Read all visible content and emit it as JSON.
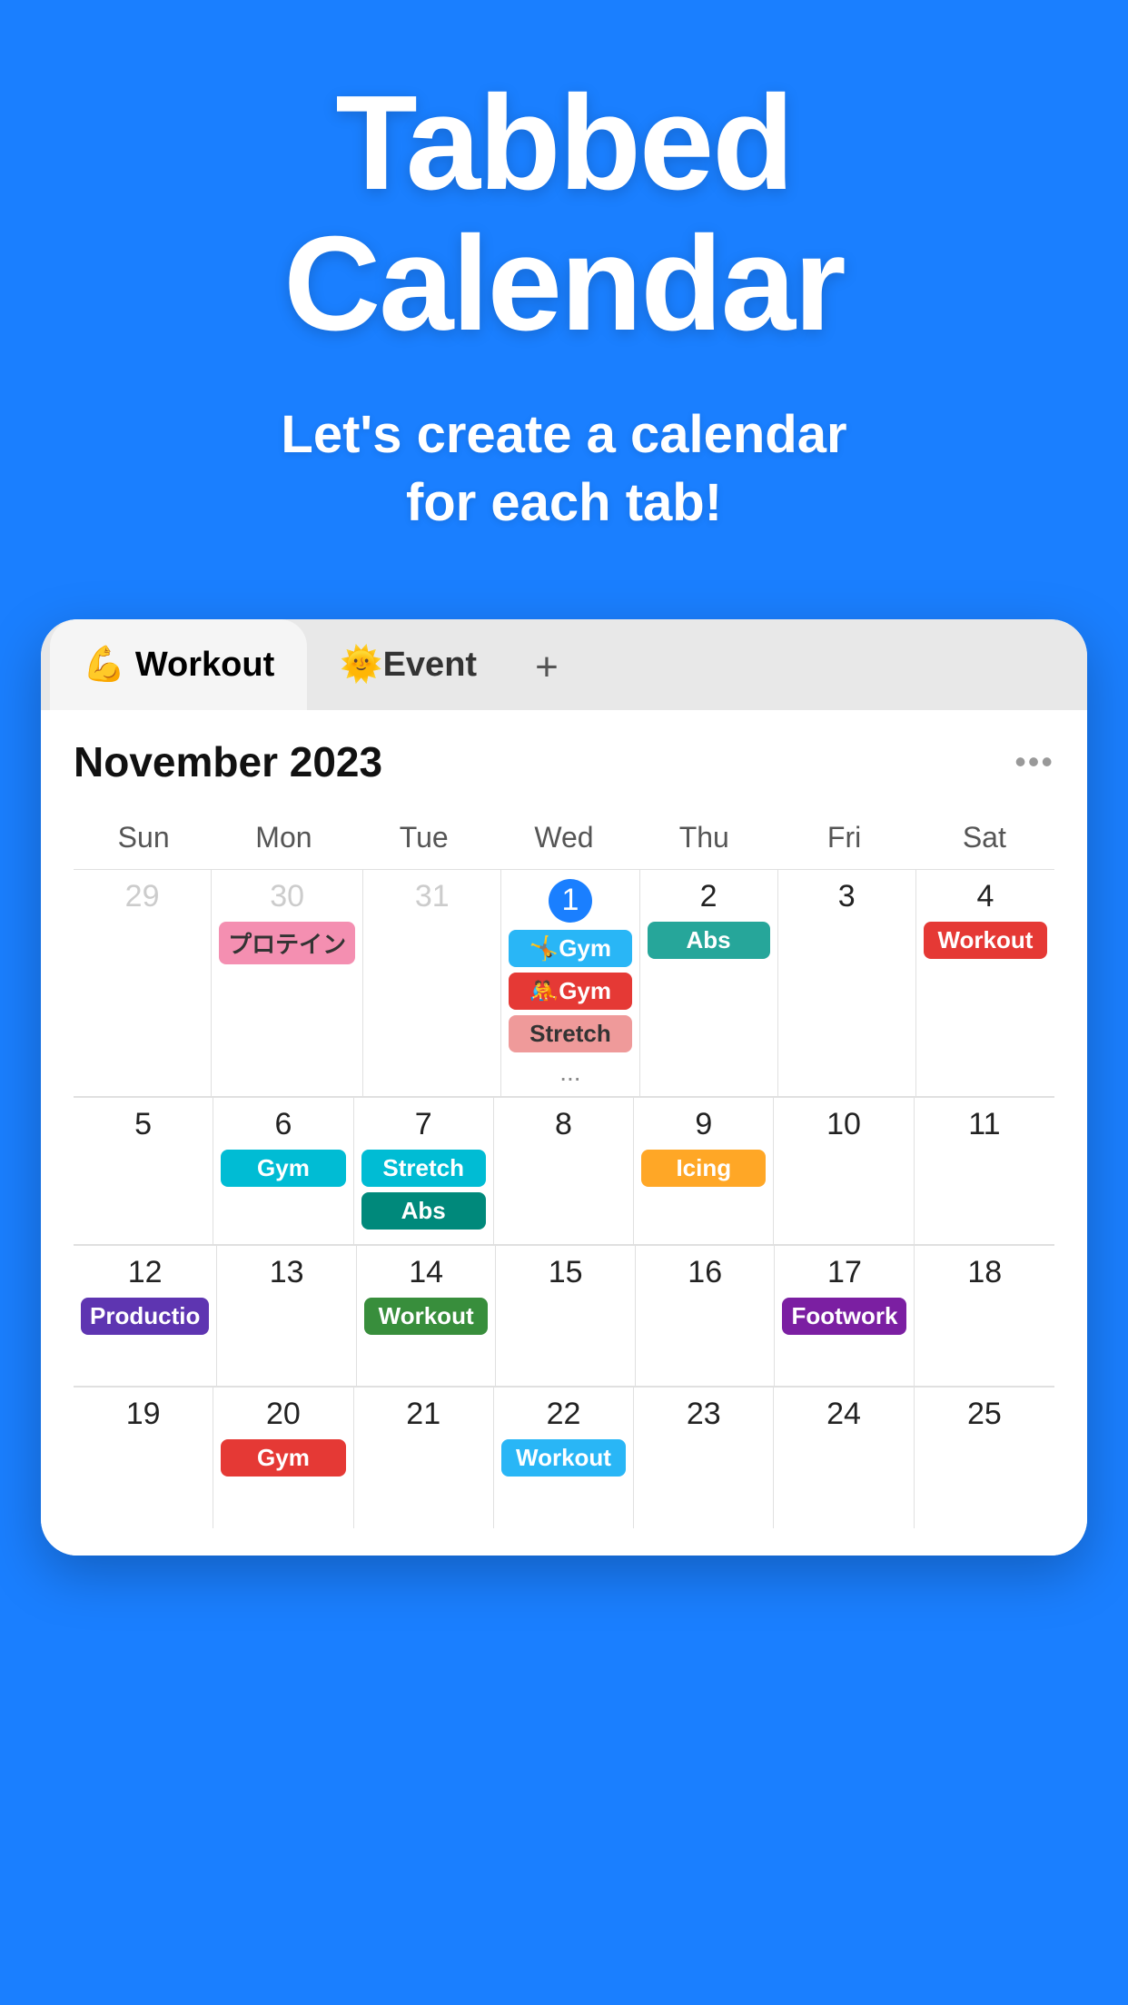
{
  "hero": {
    "title": "Tabbed\nCalendar",
    "subtitle": "Let's create a calendar\nfor each tab!"
  },
  "tabs": [
    {
      "id": "workout",
      "label": "💪 Workout",
      "active": true
    },
    {
      "id": "event",
      "label": "🌞Event",
      "active": false
    }
  ],
  "tab_add_label": "+",
  "calendar": {
    "month_title": "November 2023",
    "menu_dots": "•••",
    "days_of_week": [
      "Sun",
      "Mon",
      "Tue",
      "Wed",
      "Thu",
      "Fri",
      "Sat"
    ],
    "weeks": [
      {
        "days": [
          {
            "num": "29",
            "other_month": true,
            "events": []
          },
          {
            "num": "30",
            "other_month": true,
            "events": [
              {
                "label": "プロテイン",
                "color": "event-pink"
              }
            ]
          },
          {
            "num": "31",
            "other_month": true,
            "events": []
          },
          {
            "num": "1",
            "today": true,
            "events": [
              {
                "label": "🤸Gym",
                "color": "event-blue"
              },
              {
                "label": "🤼Gym",
                "color": "event-red"
              },
              {
                "label": "Stretch",
                "color": "event-salmon"
              }
            ],
            "more": "..."
          },
          {
            "num": "2",
            "events": [
              {
                "label": "Abs",
                "color": "event-green"
              }
            ]
          },
          {
            "num": "3",
            "events": []
          },
          {
            "num": "4",
            "events": [
              {
                "label": "Workout",
                "color": "event-red"
              }
            ]
          }
        ]
      },
      {
        "days": [
          {
            "num": "5",
            "events": []
          },
          {
            "num": "6",
            "events": [
              {
                "label": "Gym",
                "color": "event-cyan"
              }
            ]
          },
          {
            "num": "7",
            "events": [
              {
                "label": "Stretch",
                "color": "event-cyan"
              },
              {
                "label": "Abs",
                "color": "event-teal"
              }
            ]
          },
          {
            "num": "8",
            "events": []
          },
          {
            "num": "9",
            "events": [
              {
                "label": "Icing",
                "color": "event-orange"
              }
            ]
          },
          {
            "num": "10",
            "events": []
          },
          {
            "num": "11",
            "events": []
          }
        ]
      },
      {
        "days": [
          {
            "num": "12",
            "events": [
              {
                "label": "Productio",
                "color": "event-violet"
              }
            ]
          },
          {
            "num": "13",
            "events": []
          },
          {
            "num": "14",
            "events": [
              {
                "label": "Workout",
                "color": "event-darkgreen"
              }
            ]
          },
          {
            "num": "15",
            "events": []
          },
          {
            "num": "16",
            "events": []
          },
          {
            "num": "17",
            "events": [
              {
                "label": "Footwork",
                "color": "event-footwork"
              }
            ]
          },
          {
            "num": "18",
            "events": []
          }
        ]
      },
      {
        "days": [
          {
            "num": "19",
            "events": []
          },
          {
            "num": "20",
            "events": [
              {
                "label": "Gym",
                "color": "event-red"
              }
            ]
          },
          {
            "num": "21",
            "events": []
          },
          {
            "num": "22",
            "events": [
              {
                "label": "Workout",
                "color": "event-blue"
              }
            ]
          },
          {
            "num": "23",
            "events": []
          },
          {
            "num": "24",
            "events": []
          },
          {
            "num": "25",
            "events": []
          }
        ]
      }
    ]
  }
}
